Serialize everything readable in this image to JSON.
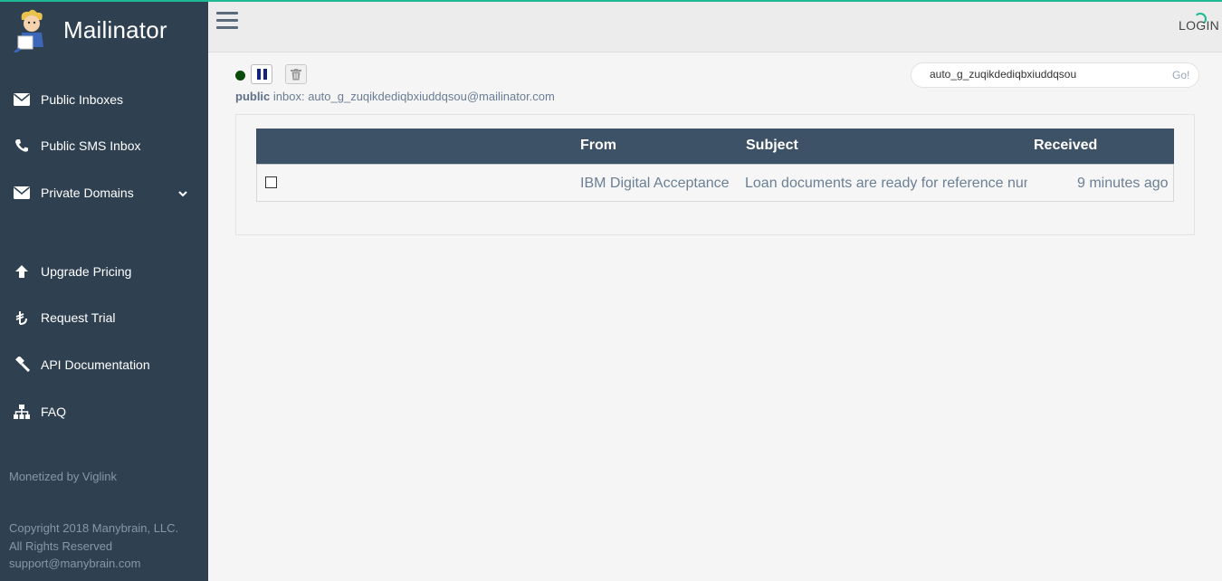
{
  "sidebar": {
    "brand": "Mailinator",
    "items": [
      {
        "label": "Public Inboxes",
        "icon": "envelope-icon"
      },
      {
        "label": "Public SMS Inbox",
        "icon": "phone-icon"
      },
      {
        "label": "Private Domains",
        "icon": "envelope-icon"
      },
      {
        "label": "Upgrade Pricing",
        "icon": "arrow-up-icon"
      },
      {
        "label": "Request Trial",
        "icon": "currency-icon"
      },
      {
        "label": "API Documentation",
        "icon": "gavel-icon"
      },
      {
        "label": "FAQ",
        "icon": "sitemap-icon"
      }
    ],
    "monetized": "Monetized by Viglink",
    "copyright": "Copyright 2018 Manybrain, LLC.",
    "rights": "All Rights Reserved",
    "support": "support@manybrain.com"
  },
  "topbar": {
    "login": "LOGIN"
  },
  "inbox": {
    "type": "public",
    "label": " inbox: ",
    "address": "auto_g_zuqikdediqbxiuddqsou@mailinator.com"
  },
  "search": {
    "value": "auto_g_zuqikdediqbxiuddqsou",
    "go": "Go!"
  },
  "table": {
    "headers": {
      "from": "From",
      "subject": "Subject",
      "received": "Received"
    },
    "rows": [
      {
        "from": "IBM Digital Acceptance",
        "subject": "Loan documents are ready for reference number",
        "received": "9 minutes ago"
      }
    ]
  },
  "colors": {
    "sidebar": "#2f4051",
    "table_header": "#3d5266",
    "accent": "#1fb995"
  }
}
